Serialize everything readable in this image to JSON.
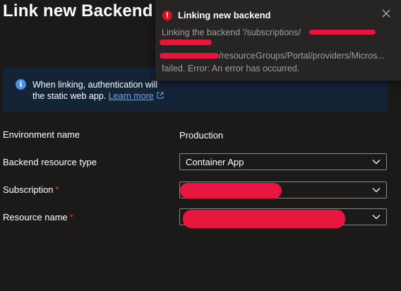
{
  "page": {
    "title": "Link new Backend"
  },
  "info_bar": {
    "text": "When linking, authentication will",
    "text2": "the static web app.",
    "learn_more": "Learn more",
    "icon": "info-icon"
  },
  "form": {
    "environment": {
      "label": "Environment name",
      "value": "Production"
    },
    "backend_type": {
      "label": "Backend resource type",
      "value": "Container App"
    },
    "subscription": {
      "label": "Subscription",
      "required_mark": "*",
      "value": ""
    },
    "resource_name": {
      "label": "Resource name",
      "required_mark": "*",
      "value": ""
    }
  },
  "toast": {
    "title": "Linking new backend",
    "line1": "Linking the backend '/subscriptions/",
    "line2": "/resourceGroups/Portal/providers/Micros...",
    "line3": "failed. Error: An error has occurred.",
    "icon": "error-icon",
    "close_icon": "close-icon"
  },
  "colors": {
    "background": "#1b1a19",
    "info_bar": "#152337",
    "link": "#69a7f5",
    "required": "#e8334a",
    "error": "#d8102b",
    "redaction": "#e8153f"
  }
}
